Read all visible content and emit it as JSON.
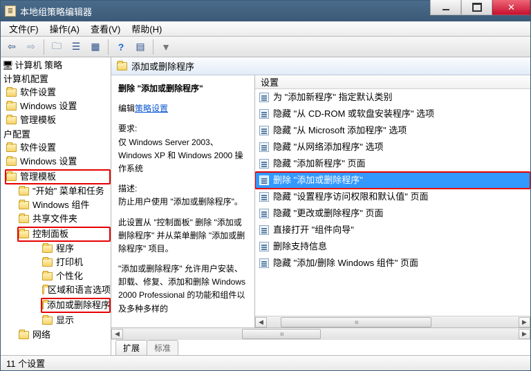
{
  "window": {
    "title": "本地组策略编辑器"
  },
  "menubar": {
    "file": "文件(F)",
    "action": "操作(A)",
    "view": "查看(V)",
    "help": "帮助(H)"
  },
  "tree": {
    "root": "计算机 策略",
    "computer_config": "计算机配置",
    "cc_software": "软件设置",
    "cc_windows": "Windows 设置",
    "cc_admin": "管理模板",
    "user_config": "户配置",
    "uc_software": "软件设置",
    "uc_windows": "Windows 设置",
    "uc_admin": "管理模板",
    "start_menu": "\"开始\" 菜单和任务",
    "win_components": "Windows 组件",
    "shared_folders": "共享文件夹",
    "control_panel": "控制面板",
    "programs": "程序",
    "printers": "打印机",
    "personalization": "个性化",
    "region_lang": "区域和语言选项",
    "add_remove": "添加或删除程序",
    "display": "显示",
    "network": "网络"
  },
  "path_bar": {
    "label": "添加或删除程序"
  },
  "desc": {
    "heading": "删除 \"添加或删除程序\"",
    "edit_label": "编辑",
    "edit_link": "策略设置",
    "req_label": "要求:",
    "req_text": "仅 Windows Server 2003、Windows XP 和 Windows 2000 操作系统",
    "desc_label": "描述:",
    "desc_text": "防止用户使用 \"添加或删除程序\"。",
    "para1": "此设置从 \"控制面板\" 删除 \"添加或删除程序\" 并从菜单删除 \"添加或删除程序\" 项目。",
    "para2": "\"添加或删除程序\" 允许用户安装、卸载、修复、添加和删除 Windows 2000 Professional 的功能和组件以及多种多样的"
  },
  "settings": {
    "header": "设置",
    "items": [
      "为 \"添加新程序\" 指定默认类别",
      "隐藏 \"从 CD-ROM 或软盘安装程序\" 选项",
      "隐藏 \"从 Microsoft 添加程序\" 选项",
      "隐藏 \"从网络添加程序\" 选项",
      "隐藏 \"添加新程序\" 页面",
      "删除 \"添加或删除程序\"",
      "隐藏 \"设置程序访问权限和默认值\" 页面",
      "隐藏 \"更改或删除程序\" 页面",
      "直接打开 \"组件向导\"",
      "删除支持信息",
      "隐藏 \"添加/删除 Windows 组件\" 页面"
    ],
    "selected_index": 5
  },
  "tabs": {
    "extended": "扩展",
    "standard": "标准"
  },
  "statusbar": {
    "text": "11 个设置"
  }
}
